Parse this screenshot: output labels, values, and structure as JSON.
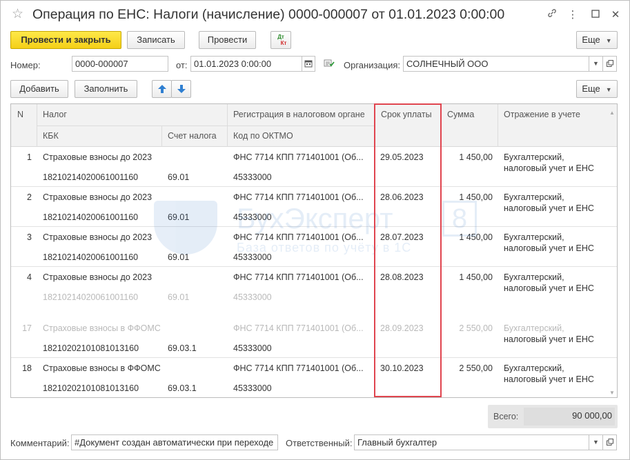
{
  "window": {
    "title": "Операция по ЕНС: Налоги (начисление) 0000-000007 от 01.01.2023 0:00:00",
    "controls": [
      "link-icon",
      "more-icon",
      "maximize-icon",
      "close-icon"
    ]
  },
  "toolbar": {
    "post_close": "Провести и закрыть",
    "save": "Записать",
    "post": "Провести",
    "dtkt_top": "Дт",
    "dtkt_bottom": "Кт",
    "more": "Еще"
  },
  "header": {
    "number_label": "Номер:",
    "number_value": "0000-000007",
    "date_label": "от:",
    "date_value": "01.01.2023  0:00:00",
    "org_label": "Организация:",
    "org_value": "СОЛНЕЧНЫЙ ООО"
  },
  "table_toolbar": {
    "add": "Добавить",
    "fill": "Заполнить",
    "more": "Еще"
  },
  "table": {
    "headers": {
      "n": "N",
      "tax": "Налог",
      "kbk": "КБК",
      "account": "Счет налога",
      "registration": "Регистрация в налоговом органе",
      "oktmo": "Код по ОКТМО",
      "due_date": "Срок уплаты",
      "amount": "Сумма",
      "reflection": "Отражение в учете"
    },
    "rows": [
      {
        "n": "1",
        "tax": "Страховые взносы до 2023",
        "kbk": "18210214020061001160",
        "account": "69.01",
        "registration": "ФНС 7714 КПП 771401001 (Об...",
        "oktmo": "45333000",
        "due_date": "29.05.2023",
        "amount": "1 450,00",
        "reflection_1": "Бухгалтерский,",
        "reflection_2": "налоговый учет и ЕНС"
      },
      {
        "n": "2",
        "tax": "Страховые взносы до 2023",
        "kbk": "18210214020061001160",
        "account": "69.01",
        "registration": "ФНС 7714 КПП 771401001 (Об...",
        "oktmo": "45333000",
        "due_date": "28.06.2023",
        "amount": "1 450,00",
        "reflection_1": "Бухгалтерский,",
        "reflection_2": "налоговый учет и ЕНС"
      },
      {
        "n": "3",
        "tax": "Страховые взносы до 2023",
        "kbk": "18210214020061001160",
        "account": "69.01",
        "registration": "ФНС 7714 КПП 771401001 (Об...",
        "oktmo": "45333000",
        "due_date": "28.07.2023",
        "amount": "1 450,00",
        "reflection_1": "Бухгалтерский,",
        "reflection_2": "налоговый учет и ЕНС"
      },
      {
        "n": "4",
        "tax": "Страховые взносы до 2023",
        "kbk": "18210214020061001160",
        "account": "69.01",
        "registration": "ФНС 7714 КПП 771401001 (Об...",
        "oktmo": "45333000",
        "due_date": "28.08.2023",
        "amount": "1 450,00",
        "reflection_1": "Бухгалтерский,",
        "reflection_2": "налоговый учет и ЕНС"
      },
      {
        "n": "17",
        "tax": "Страховые взносы в ФФОМС",
        "kbk": "18210202101081013160",
        "account": "69.03.1",
        "registration": "ФНС 7714 КПП 771401001 (Об...",
        "oktmo": "45333000",
        "due_date": "28.09.2023",
        "amount": "2 550,00",
        "reflection_1": "Бухгалтерский,",
        "reflection_2": "налоговый учет и ЕНС"
      },
      {
        "n": "18",
        "tax": "Страховые взносы в ФФОМС",
        "kbk": "18210202101081013160",
        "account": "69.03.1",
        "registration": "ФНС 7714 КПП 771401001 (Об...",
        "oktmo": "45333000",
        "due_date": "30.10.2023",
        "amount": "2 550,00",
        "reflection_1": "Бухгалтерский,",
        "reflection_2": "налоговый учет и ЕНС"
      }
    ]
  },
  "watermark": {
    "brand": "БухЭксперт",
    "badge": "8",
    "tagline": "База ответов по учёту в 1С"
  },
  "footer": {
    "total_label": "Всего:",
    "total_value": "90 000,00",
    "comment_label": "Комментарий:",
    "comment_value": "#Документ создан автоматически при переходе",
    "responsible_label": "Ответственный:",
    "responsible_value": "Главный бухгалтер"
  },
  "colors": {
    "primary_button": "#f4cf17",
    "highlight": "#e0444e",
    "arrow_blue": "#2f7fd1"
  }
}
